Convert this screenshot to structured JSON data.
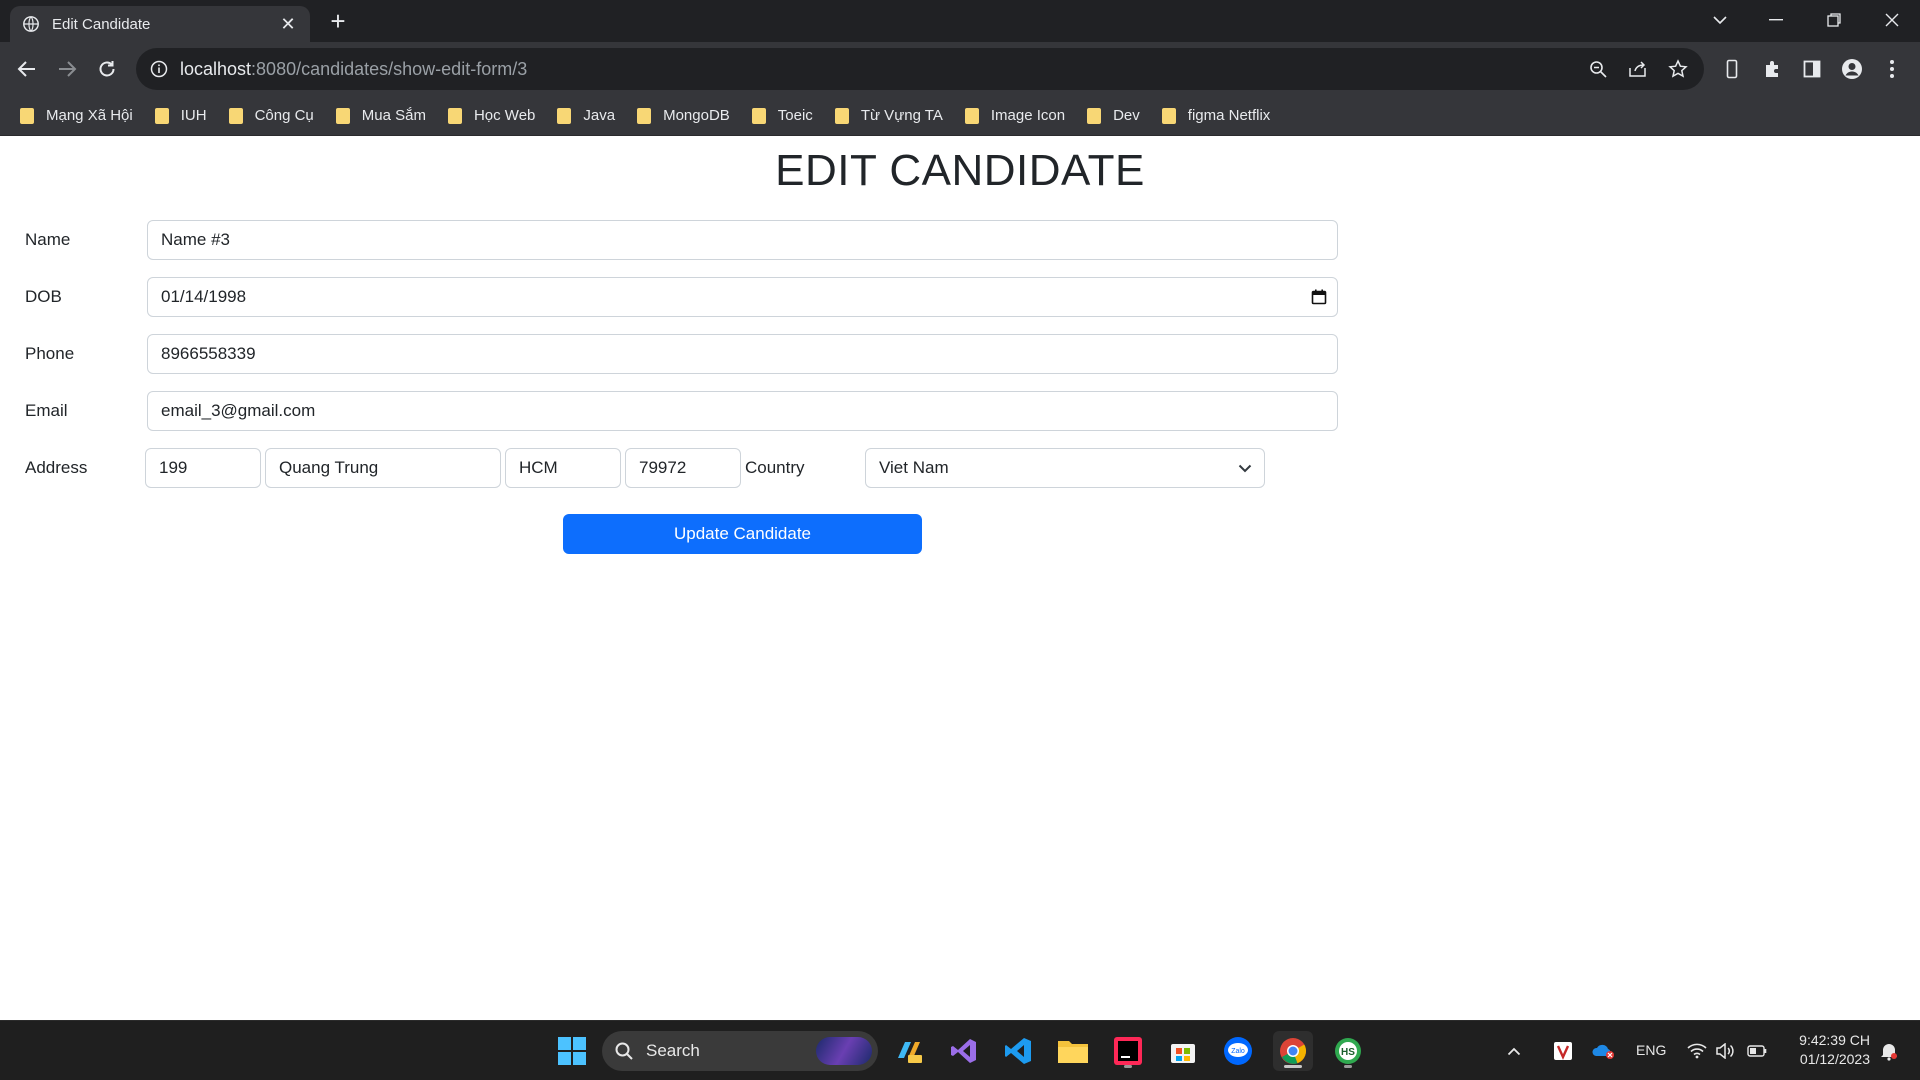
{
  "browser": {
    "tab_title": "Edit Candidate",
    "url_host": "localhost",
    "url_rest": ":8080/candidates/show-edit-form/3",
    "bookmarks": [
      "Mạng Xã Hội",
      "IUH",
      "Công Cụ",
      "Mua Sắm",
      "Học Web",
      "Java",
      "MongoDB",
      "Toeic",
      "Từ Vựng TA",
      "Image Icon",
      "Dev",
      "figma Netflix"
    ]
  },
  "page": {
    "title": "EDIT CANDIDATE",
    "fields": {
      "name": {
        "label": "Name",
        "value": "Name #3"
      },
      "dob": {
        "label": "DOB",
        "value": "01/14/1998"
      },
      "phone": {
        "label": "Phone",
        "value": "8966558339"
      },
      "email": {
        "label": "Email",
        "value": "email_3@gmail.com"
      }
    },
    "address": {
      "label": "Address",
      "number": "199",
      "street": "Quang Trung",
      "city": "HCM",
      "zipcode": "79972",
      "country_label": "Country",
      "country_value": "Viet Nam"
    },
    "submit_label": "Update Candidate"
  },
  "taskbar": {
    "search_label": "Search",
    "language": "ENG",
    "time": "9:42:39 CH",
    "date": "01/12/2023"
  },
  "colors": {
    "primary": "#0d6efd",
    "chrome_dark": "#202124",
    "chrome_mid": "#35363a",
    "folder": "#f8d775"
  }
}
